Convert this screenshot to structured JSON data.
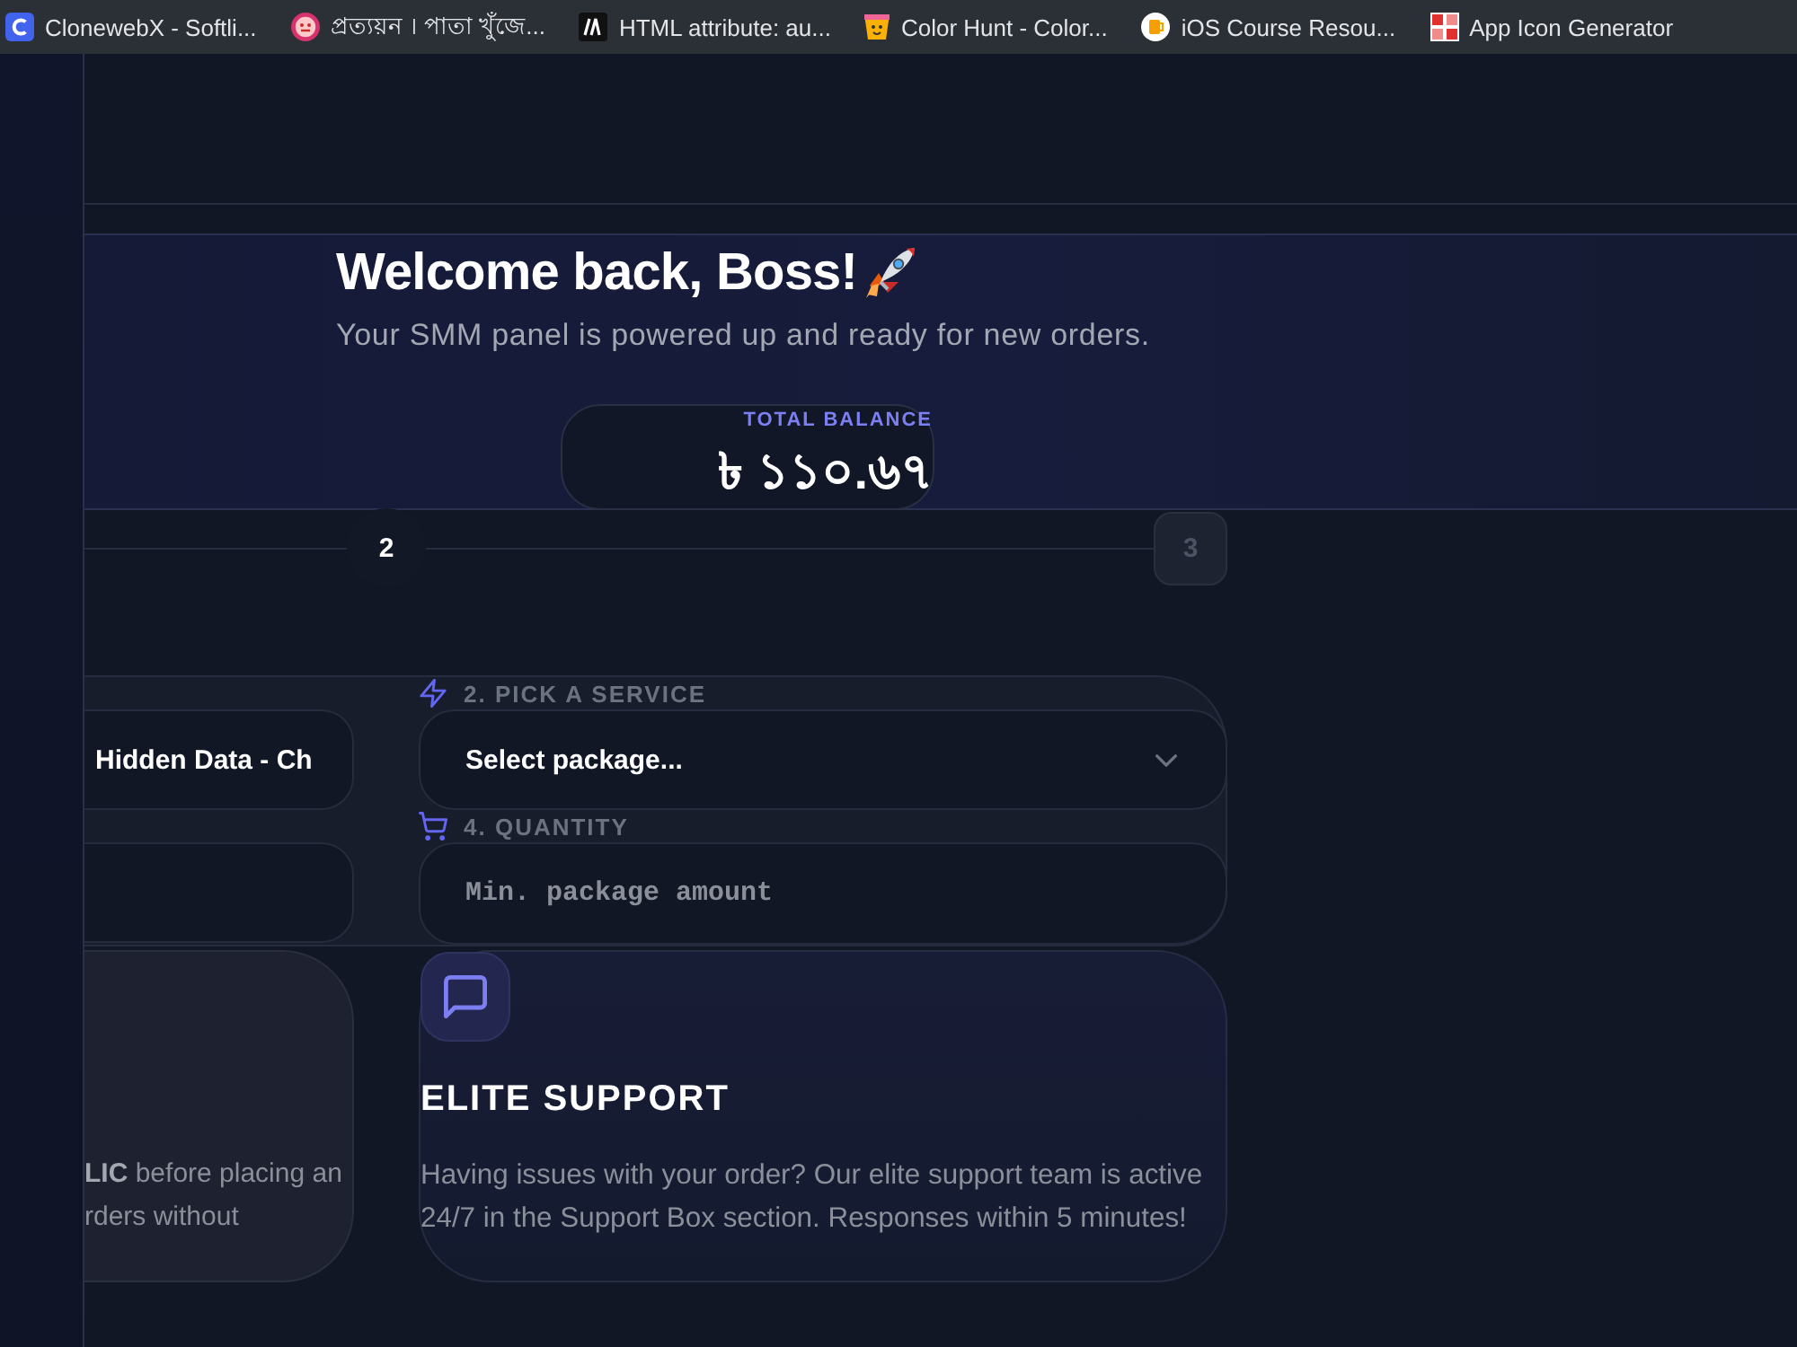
{
  "bookmarks": [
    {
      "title": "ClonewebX - Softli..."
    },
    {
      "title": "প্রত্যয়ন । পাতা খুঁজে..."
    },
    {
      "title": "HTML attribute: au..."
    },
    {
      "title": "Color Hunt - Color..."
    },
    {
      "title": "iOS Course Resou..."
    },
    {
      "title": "App Icon Generator"
    }
  ],
  "welcome": {
    "title": "Welcome back, Boss!",
    "subtitle": "Your SMM panel is powered up and ready for new orders.",
    "balance": {
      "label": "TOTAL BALANCE",
      "amount": "৳ ১১০.৬৭"
    }
  },
  "steps": [
    {
      "label": "2",
      "current": true
    },
    {
      "label": "3",
      "current": false
    }
  ],
  "order_form": {
    "fields": [
      {
        "kind": "text",
        "value": "Hidden Data - Ch"
      },
      {
        "kind": "select",
        "label": "2. PICK A SERVICE",
        "value": "Select package..."
      },
      {
        "kind": "input"
      },
      {
        "kind": "input",
        "label": "4. QUANTITY",
        "placeholder": "Min. package amount"
      }
    ]
  },
  "cards": [
    {
      "kind": "note",
      "lines": [
        "**LIC** before placing an",
        "rders without"
      ]
    },
    {
      "kind": "feature",
      "title": "ELITE SUPPORT",
      "text": "Having issues with your order? Our elite support team is active 24/7 in the Support Box section. Responses within 5 minutes!"
    }
  ]
}
